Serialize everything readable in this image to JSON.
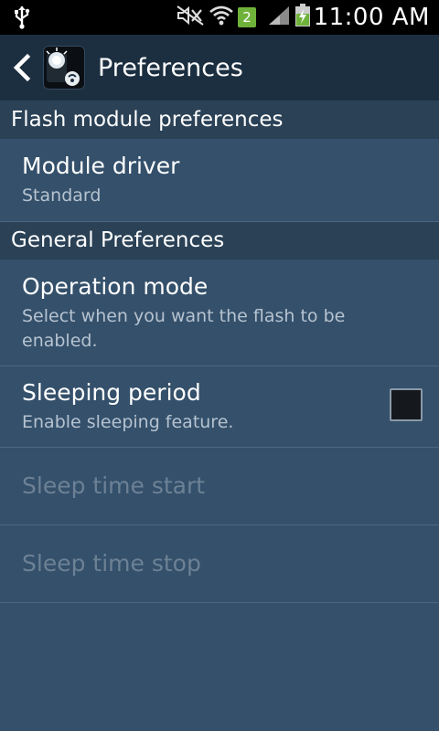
{
  "status_bar": {
    "time": "11:00 AM",
    "notification_count": "2",
    "icons": [
      "usb-icon",
      "mute-icon",
      "wifi-icon",
      "signal-icon",
      "battery-charging-icon"
    ]
  },
  "action_bar": {
    "title": "Preferences",
    "back_icon": "chevron-left-icon",
    "app_icon": "flashlight-app-icon"
  },
  "sections": [
    {
      "header": "Flash module preferences",
      "items": [
        {
          "title": "Module driver",
          "summary": "Standard"
        }
      ]
    },
    {
      "header": "General Preferences",
      "items": [
        {
          "title": "Operation mode",
          "summary": "Select when you want the flash to be enabled."
        },
        {
          "title": "Sleeping period",
          "summary": "Enable sleeping feature.",
          "checkbox_checked": false
        },
        {
          "title": "Sleep time start",
          "enabled": false
        },
        {
          "title": "Sleep time stop",
          "enabled": false
        }
      ]
    }
  ],
  "colors": {
    "background": "#34506b",
    "action_bar": "#1c2f41",
    "section_header": "#2a4156",
    "disabled_text": "#6d8195"
  }
}
